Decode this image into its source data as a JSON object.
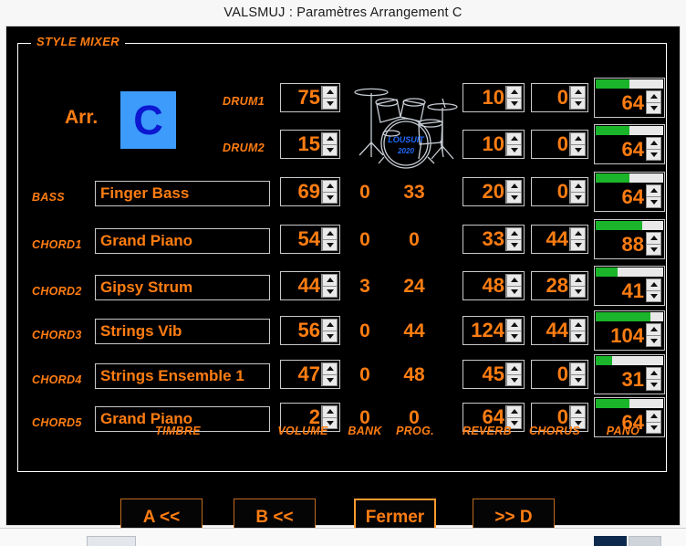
{
  "window": {
    "title": "VALSMUJ  :   Paramètres Arrangement C"
  },
  "group": {
    "legend": "STYLE MIXER"
  },
  "arrangement": {
    "label": "Arr.",
    "value": "C",
    "badge_bg": "#3d9bfb",
    "badge_fg": "#0b17d0"
  },
  "colors": {
    "accent": "#ff7d12",
    "background": "#000000",
    "bar_green": "#1ab52a",
    "field_border": "#c9c9c9"
  },
  "icons": {
    "drumkit": "drum-kit-icon",
    "spin_up": "triangle-up-icon",
    "spin_down": "triangle-down-icon"
  },
  "columns": {
    "timbre": "TIMBRE",
    "volume": "VOLUME",
    "bank": "BANK",
    "prog": "PROG.",
    "reverb": "REVERB",
    "chorus": "CHORUS",
    "pano": "PANO"
  },
  "rows": [
    {
      "label": "DRUM1",
      "timbre": null,
      "volume": "75",
      "bank": null,
      "prog": null,
      "reverb": "10",
      "chorus": "0",
      "pano": "64",
      "pano_pct": 50
    },
    {
      "label": "DRUM2",
      "timbre": null,
      "volume": "15",
      "bank": null,
      "prog": null,
      "reverb": "10",
      "chorus": "0",
      "pano": "64",
      "pano_pct": 50
    },
    {
      "label": "BASS",
      "timbre": "Finger Bass",
      "volume": "69",
      "bank": "0",
      "prog": "33",
      "reverb": "20",
      "chorus": "0",
      "pano": "64",
      "pano_pct": 50
    },
    {
      "label": "CHORD1",
      "timbre": "Grand Piano",
      "volume": "54",
      "bank": "0",
      "prog": "0",
      "reverb": "33",
      "chorus": "44",
      "pano": "88",
      "pano_pct": 69
    },
    {
      "label": "CHORD2",
      "timbre": "Gipsy Strum",
      "volume": "44",
      "bank": "3",
      "prog": "24",
      "reverb": "48",
      "chorus": "28",
      "pano": "41",
      "pano_pct": 32
    },
    {
      "label": "CHORD3",
      "timbre": "Strings Vib",
      "volume": "56",
      "bank": "0",
      "prog": "44",
      "reverb": "124",
      "chorus": "44",
      "pano": "104",
      "pano_pct": 81
    },
    {
      "label": "CHORD4",
      "timbre": "Strings Ensemble 1",
      "volume": "47",
      "bank": "0",
      "prog": "48",
      "reverb": "45",
      "chorus": "0",
      "pano": "31",
      "pano_pct": 24
    },
    {
      "label": "CHORD5",
      "timbre": "Grand Piano",
      "volume": "2",
      "bank": "0",
      "prog": "0",
      "reverb": "64",
      "chorus": "0",
      "pano": "64",
      "pano_pct": 50
    }
  ],
  "buttons": {
    "prev_a": "A <<",
    "prev_b": "B <<",
    "close": "Fermer",
    "next_d": ">> D"
  }
}
